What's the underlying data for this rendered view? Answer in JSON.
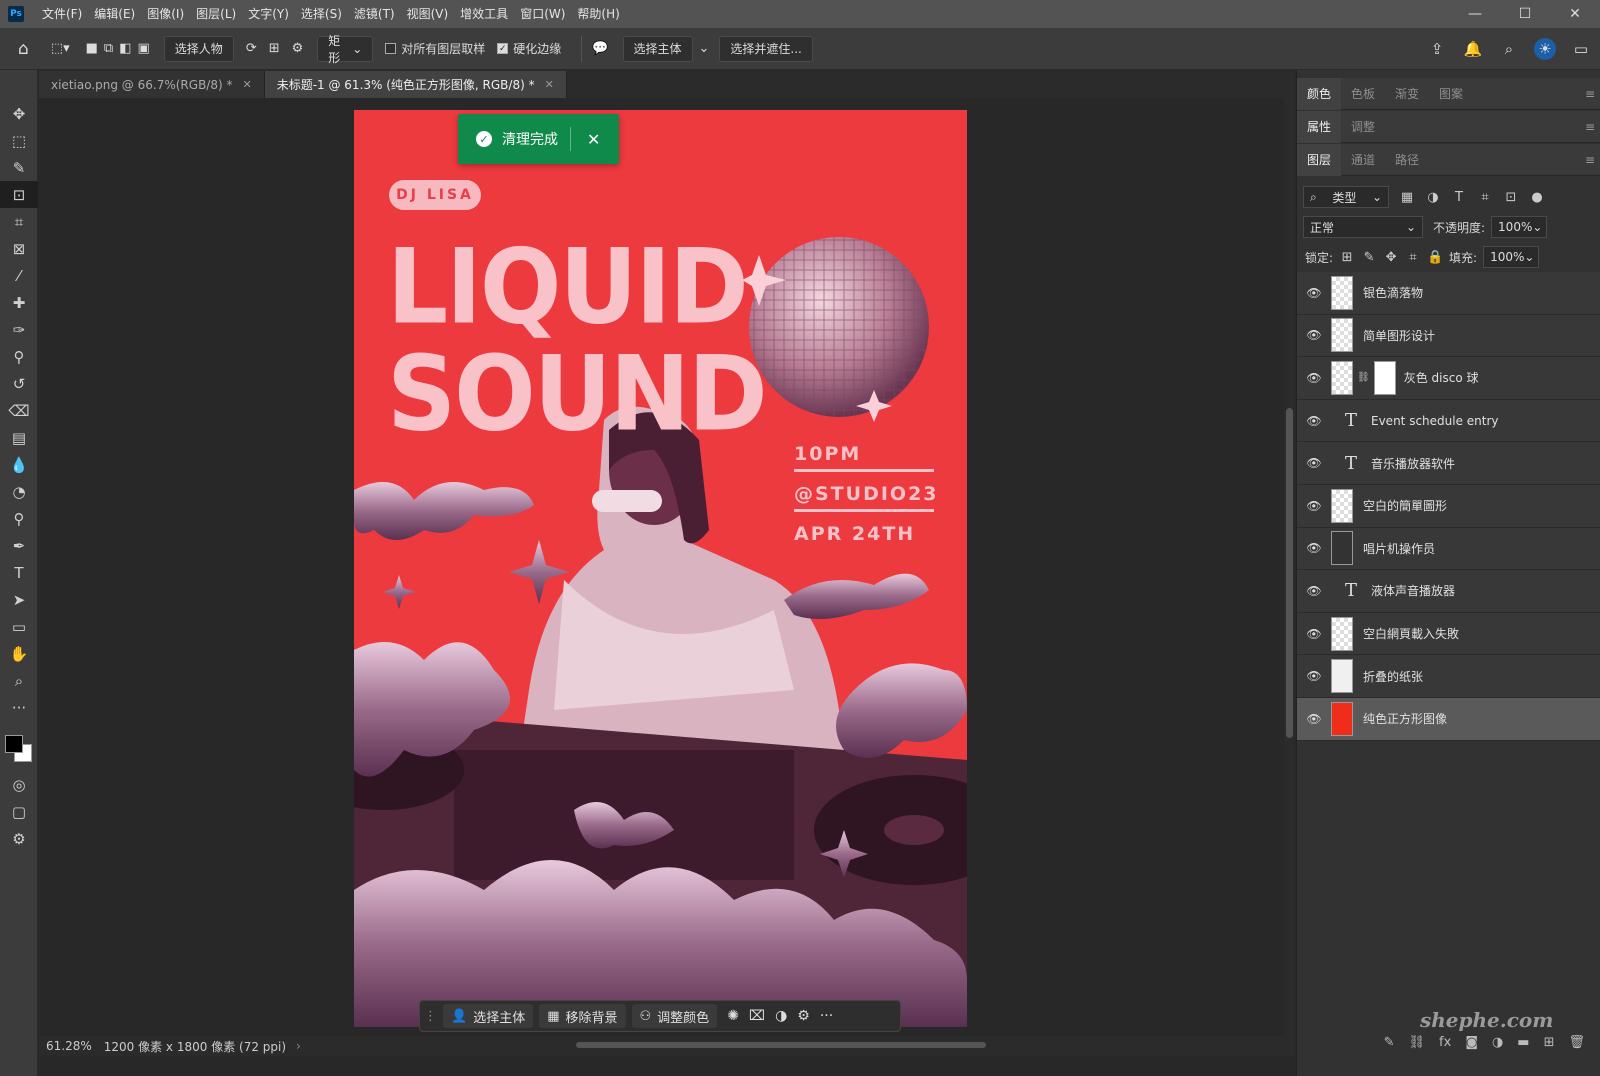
{
  "app": {
    "logo": "Ps"
  },
  "menu": [
    "文件(F)",
    "编辑(E)",
    "图像(I)",
    "图层(L)",
    "文字(Y)",
    "选择(S)",
    "滤镜(T)",
    "视图(V)",
    "增效工具",
    "窗口(W)",
    "帮助(H)"
  ],
  "window_controls": {
    "minimize": "—",
    "maximize": "☐",
    "close": "✕"
  },
  "options": {
    "select_subject_mode": "选择人物",
    "shape": "矩形",
    "sample_all_layers": {
      "label": "对所有图层取样",
      "checked": false
    },
    "hard_edge": {
      "label": "硬化边缘",
      "checked": true
    },
    "select_subject": "选择主体",
    "select_and_mask": "选择并遮住..."
  },
  "tabs": [
    {
      "label": "xietiao.png @ 66.7%(RGB/8) *",
      "active": false
    },
    {
      "label": "未标题-1 @ 61.3% (纯色正方形图像, RGB/8) *",
      "active": true
    }
  ],
  "toast": {
    "text": "清理完成",
    "close": "✕"
  },
  "poster": {
    "dj": "DJ LISA",
    "title_1": "LIQUID",
    "title_2": "SOUND",
    "time": "10PM",
    "venue": "@STUDIO23",
    "date": "APR 24TH"
  },
  "context_bar": {
    "select_subject": "选择主体",
    "remove_bg": "移除背景",
    "adjust_color": "调整颜色",
    "more": "···"
  },
  "status": {
    "zoom": "61.28%",
    "doc_info": "1200 像素 x 1800 像素 (72 ppi)"
  },
  "panels": {
    "group1": [
      "颜色",
      "色板",
      "渐变",
      "图案"
    ],
    "group2": [
      "属性",
      "调整"
    ],
    "group3": [
      "图层",
      "通道",
      "路径"
    ],
    "filter_label": "类型",
    "blend_mode": "正常",
    "opacity_label": "不透明度:",
    "opacity_value": "100%",
    "lock_label": "锁定:",
    "fill_label": "填充:",
    "fill_value": "100%"
  },
  "layers": [
    {
      "name": "银色滴落物",
      "kind": "checker",
      "selected": false
    },
    {
      "name": "简单图形设计",
      "kind": "checker",
      "selected": false
    },
    {
      "name": "灰色 disco 球",
      "kind": "masked",
      "selected": false
    },
    {
      "name": "Event schedule entry",
      "kind": "type",
      "selected": false
    },
    {
      "name": "音乐播放器软件",
      "kind": "type",
      "selected": false
    },
    {
      "name": "空白的簡單圖形",
      "kind": "checker",
      "selected": false
    },
    {
      "name": "唱片机操作员",
      "kind": "dark",
      "selected": false
    },
    {
      "name": "液体声音播放器",
      "kind": "type",
      "selected": false
    },
    {
      "name": "空白網頁載入失敗",
      "kind": "checker",
      "selected": false
    },
    {
      "name": "折叠的纸张",
      "kind": "white",
      "selected": false
    },
    {
      "name": "纯色正方形图像",
      "kind": "red",
      "selected": true
    }
  ],
  "watermark": "shephe.com",
  "colors": {
    "poster_bg": "#ec3a3f",
    "accent": "#f9c2c8",
    "toast": "#0f8a4a",
    "solid_layer": "#ef2d1a"
  }
}
